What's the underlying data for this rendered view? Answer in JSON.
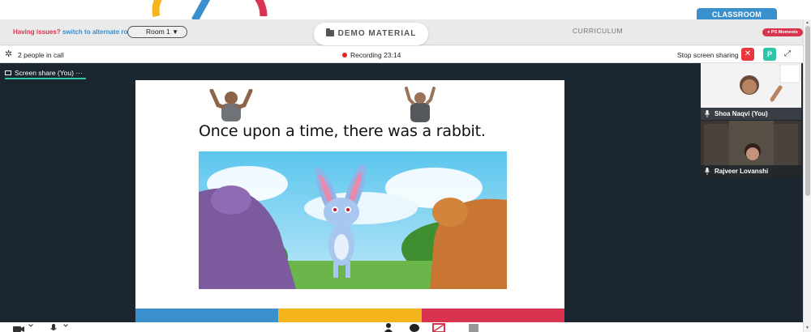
{
  "top": {
    "classroom_tab": "CLASSROOM"
  },
  "appbar": {
    "issues_question": "Having issues?",
    "issues_action": "switch to alternate room",
    "room_value": "Room 1",
    "demo_material": "DEMO MATERIAL",
    "curriculum": "CURRICULUM",
    "moments": "PS Moments"
  },
  "callbar": {
    "people_count": "2 people in call",
    "recording_label": "Recording",
    "recording_time": "23:14",
    "stop_sharing": "Stop screen sharing",
    "stop_x": "✕",
    "p_badge": "P",
    "expand": "⤢"
  },
  "stage": {
    "share_tab": "Screen share (You)",
    "share_more": "···",
    "slide_text": "Once upon a time, there was a rabbit.",
    "slide_colors": [
      "#3a8fcd",
      "#f4b41b",
      "#d9344f"
    ]
  },
  "participants": [
    {
      "name": "Shoa Naqvi (You)"
    },
    {
      "name": "Rajveer Lovanshi"
    }
  ],
  "colors": {
    "brand_red": "#d9344f",
    "brand_blue": "#3a8fcd",
    "brand_yellow": "#f4b41b",
    "teal": "#2ec4a8"
  }
}
